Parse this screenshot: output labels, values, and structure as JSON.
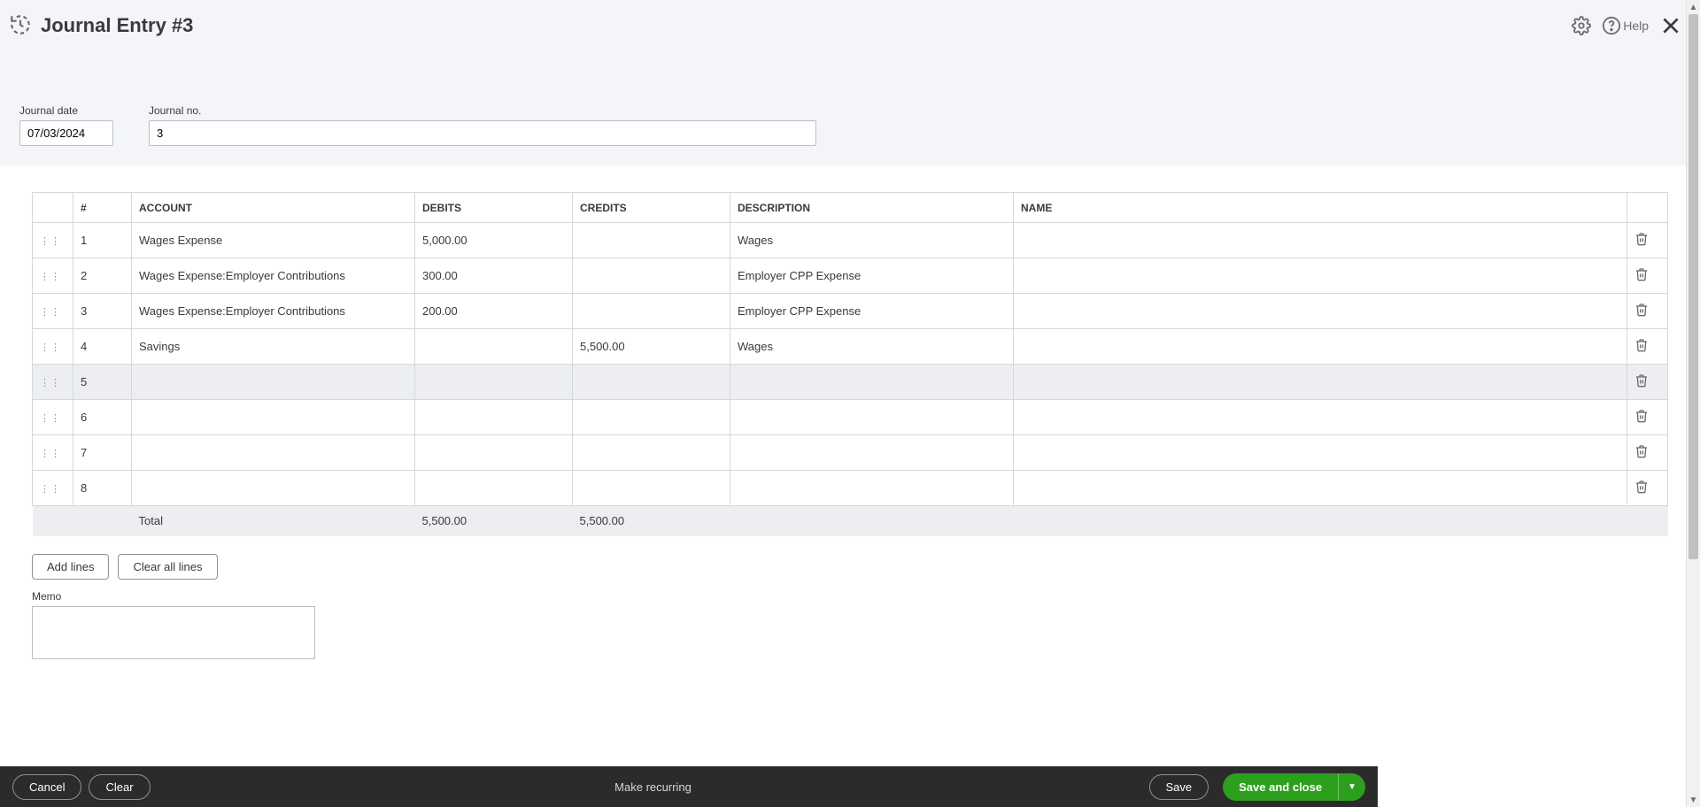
{
  "header": {
    "title": "Journal Entry #3",
    "help_label": "Help"
  },
  "meta": {
    "date_label": "Journal date",
    "date_value": "07/03/2024",
    "jno_label": "Journal no.",
    "jno_value": "3"
  },
  "table": {
    "headers": {
      "num": "#",
      "account": "ACCOUNT",
      "debits": "DEBITS",
      "credits": "CREDITS",
      "description": "DESCRIPTION",
      "name": "NAME"
    },
    "rows": [
      {
        "num": "1",
        "account": "Wages Expense",
        "debits": "5,000.00",
        "credits": "",
        "description": "Wages",
        "name": "",
        "active": false
      },
      {
        "num": "2",
        "account": "Wages Expense:Employer Contributions",
        "debits": "300.00",
        "credits": "",
        "description": "Employer CPP Expense",
        "name": "",
        "active": false
      },
      {
        "num": "3",
        "account": "Wages Expense:Employer Contributions",
        "debits": "200.00",
        "credits": "",
        "description": "Employer CPP Expense",
        "name": "",
        "active": false
      },
      {
        "num": "4",
        "account": "Savings",
        "debits": "",
        "credits": "5,500.00",
        "description": "Wages",
        "name": "",
        "active": false
      },
      {
        "num": "5",
        "account": "",
        "debits": "",
        "credits": "",
        "description": "",
        "name": "",
        "active": true
      },
      {
        "num": "6",
        "account": "",
        "debits": "",
        "credits": "",
        "description": "",
        "name": "",
        "active": false
      },
      {
        "num": "7",
        "account": "",
        "debits": "",
        "credits": "",
        "description": "",
        "name": "",
        "active": false
      },
      {
        "num": "8",
        "account": "",
        "debits": "",
        "credits": "",
        "description": "",
        "name": "",
        "active": false
      }
    ],
    "totals": {
      "label": "Total",
      "debits": "5,500.00",
      "credits": "5,500.00"
    }
  },
  "actions": {
    "add_lines": "Add lines",
    "clear_all": "Clear all lines"
  },
  "memo": {
    "label": "Memo",
    "value": ""
  },
  "footer": {
    "cancel": "Cancel",
    "clear": "Clear",
    "make_recurring": "Make recurring",
    "save": "Save",
    "save_and_close": "Save and close"
  }
}
